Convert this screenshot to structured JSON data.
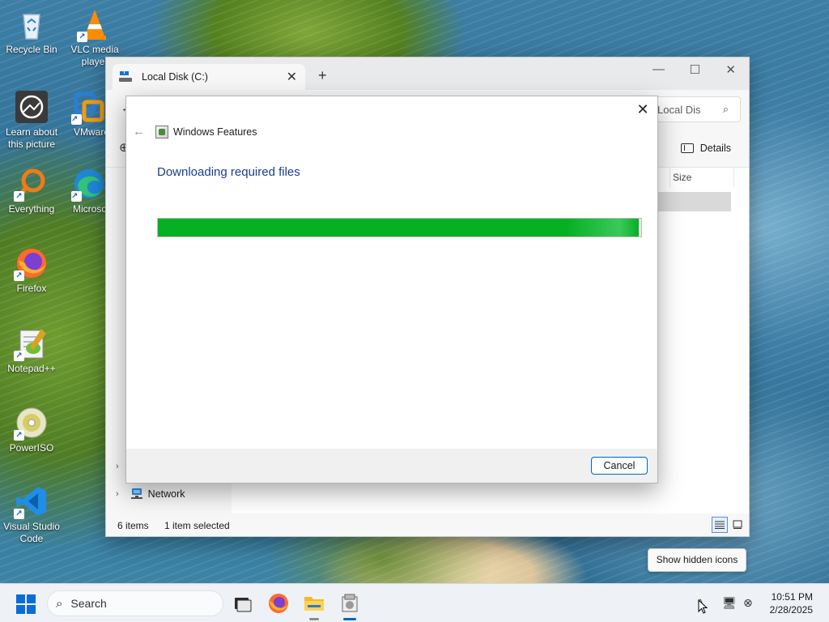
{
  "desktop": {
    "icons": [
      {
        "label": "Recycle Bin",
        "icon": "recycle-bin-icon"
      },
      {
        "label": "VLC media player",
        "icon": "vlc-icon"
      },
      {
        "label": "Learn about this picture",
        "icon": "learn-picture-icon"
      },
      {
        "label": "VMware Workstation",
        "icon": "vmware-icon"
      },
      {
        "label": "Everything",
        "icon": "everything-search-icon"
      },
      {
        "label": "Microsoft Edge",
        "icon": "edge-icon"
      },
      {
        "label": "Firefox",
        "icon": "firefox-icon"
      },
      {
        "label": "Notepad++",
        "icon": "notepadpp-icon"
      },
      {
        "label": "PowerISO",
        "icon": "poweriso-icon"
      },
      {
        "label": "Visual Studio Code",
        "icon": "vscode-icon"
      }
    ]
  },
  "explorer": {
    "tab_title": "Local Disk (C:)",
    "tab_close": "✕",
    "new_tab": "+",
    "minimize": "—",
    "maximize": "☐",
    "close": "✕",
    "search_placeholder": "Local Dis",
    "toolbar_details": "Details",
    "column_size": "Size",
    "nav_network": "Network",
    "status_items": "6 items",
    "status_selected": "1 item selected"
  },
  "dialog": {
    "title": "Windows Features",
    "heading": "Downloading required files",
    "progress": 0.995,
    "cancel_label": "Cancel",
    "close": "✕",
    "back": "←"
  },
  "tooltip": {
    "text": "Show hidden icons"
  },
  "taskbar": {
    "search_label": "Search",
    "time": "10:51 PM",
    "date": "2/28/2025",
    "apps": [
      "task-view",
      "firefox",
      "file-explorer",
      "windows-features"
    ]
  },
  "colors": {
    "accent": "#0067c0",
    "progress_green": "#06b025",
    "heading_blue": "#1a3e8c"
  }
}
